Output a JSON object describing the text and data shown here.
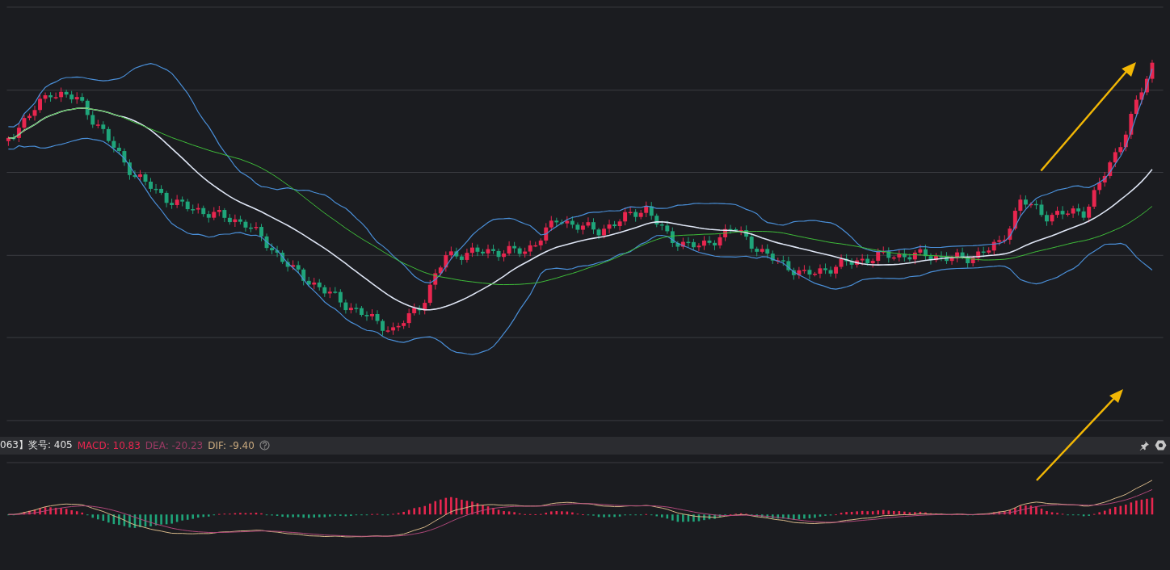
{
  "indicator_bar": {
    "draw_label": "063】奖号: 405",
    "macd": "MACD: 10.83",
    "dea": "DEA: -20.23",
    "dif": "DIF: -9.40"
  }
}
